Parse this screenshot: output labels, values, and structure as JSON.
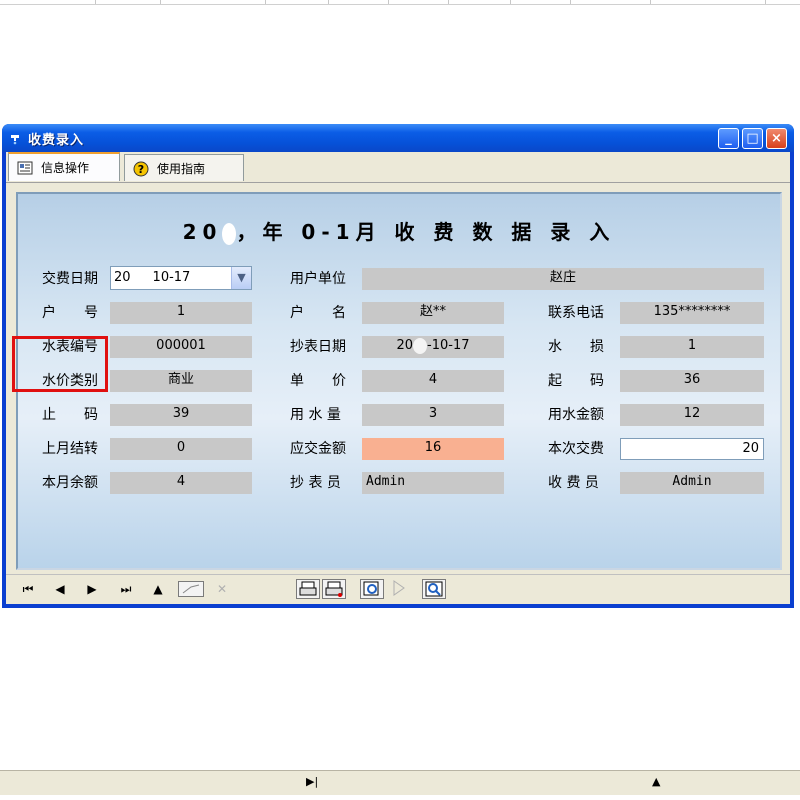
{
  "window": {
    "title": "收费录入",
    "controls": {
      "minimize": "_",
      "maximize": "□",
      "close": "×"
    }
  },
  "tabs": [
    {
      "label": "信息操作",
      "icon": "info-card-icon"
    },
    {
      "label": "使用指南",
      "icon": "help-question-icon"
    }
  ],
  "form": {
    "heading_year": "20",
    "heading_year_sep": "，",
    "heading_mid": "年 0-1",
    "heading_rest": "月 收 费 数 据 录 入",
    "fields": {
      "pay_date_label": "交费日期",
      "pay_date_value_a": "20",
      "pay_date_value_b": "10-17",
      "user_unit_label": "用户单位",
      "user_unit_value": "赵庄",
      "account_no_label": "户　　号",
      "account_no_value": "1",
      "account_name_label": "户　　名",
      "account_name_value": "赵**",
      "phone_label": "联系电话",
      "phone_value": "135********",
      "meter_no_label": "水表编号",
      "meter_no_value": "000001",
      "read_date_label": "抄表日期",
      "read_date_value_a": "20",
      "read_date_value_b": "-10-17",
      "water_loss_label": "水　　损",
      "water_loss_value": "1",
      "price_type_label": "水价类别",
      "price_type_value": "商业",
      "unit_price_label": "单　　价",
      "unit_price_value": "4",
      "start_reading_label": "起　　码",
      "start_reading_value": "36",
      "end_reading_label": "止　　码",
      "end_reading_value": "39",
      "water_qty_label": "用 水 量",
      "water_qty_value": "3",
      "water_amount_label": "用水金额",
      "water_amount_value": "12",
      "last_carry_label": "上月结转",
      "last_carry_value": "0",
      "due_amount_label": "应交金额",
      "due_amount_value": "16",
      "this_payment_label": "本次交费",
      "this_payment_value": "20",
      "month_balance_label": "本月余额",
      "month_balance_value": "4",
      "reader_label": "抄 表 员",
      "reader_value": "Admin",
      "collector_label": "收 费 员",
      "collector_value": "Admin"
    }
  },
  "toolbar": {
    "first": "⏮",
    "prev": "◀",
    "next": "▶",
    "last": "⏭",
    "up": "▲",
    "delete": "✕"
  },
  "sheet_bottom": {
    "next": "▶|",
    "up": "▲"
  }
}
